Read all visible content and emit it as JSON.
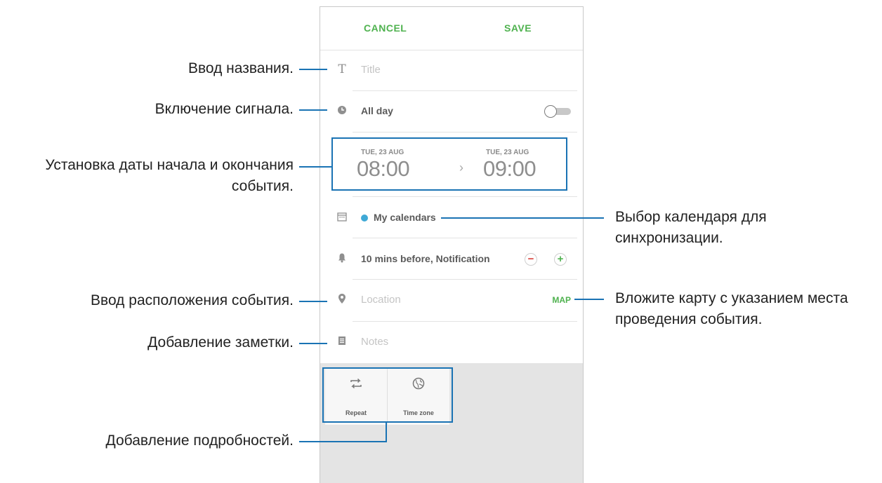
{
  "app": {
    "actionbar": {
      "cancel_label": "CANCEL",
      "save_label": "SAVE"
    },
    "title_row": {
      "placeholder": "Title",
      "icon": "text-format-icon"
    },
    "allday_row": {
      "label": "All day",
      "toggle_on": false,
      "icon": "clock-icon"
    },
    "date_row": {
      "start_date": "TUE, 23 AUG",
      "start_time": "08:00",
      "end_date": "TUE, 23 AUG",
      "end_time": "09:00",
      "arrow": "›"
    },
    "calendar_row": {
      "label": "My calendars",
      "dot_color": "#3fa9d6",
      "icon": "calendar-icon"
    },
    "reminder_row": {
      "label": "10 mins before, Notification",
      "minus": "−",
      "plus": "+",
      "icon": "bell-icon"
    },
    "location_row": {
      "placeholder": "Location",
      "map_label": "MAP",
      "icon": "location-pin-icon"
    },
    "notes_row": {
      "placeholder": "Notes",
      "icon": "notes-icon"
    },
    "tiles": [
      {
        "label": "Repeat",
        "icon": "repeat-icon"
      },
      {
        "label": "Time zone",
        "icon": "globe-icon"
      }
    ],
    "accent_color": "#4fb24f"
  },
  "annotations": {
    "title": "Ввод названия.",
    "alarm": "Включение сигнала.",
    "dates_line1": "Установка даты начала и окончания",
    "dates_line2": "события.",
    "calendar_line1": "Выбор календаря для",
    "calendar_line2": "синхронизации.",
    "location": "Ввод расположения события.",
    "map_line1": "Вложите карту с указанием места",
    "map_line2": "проведения события.",
    "notes": "Добавление заметки.",
    "details": "Добавление подробностей.",
    "line_color": "#1a73b4"
  }
}
